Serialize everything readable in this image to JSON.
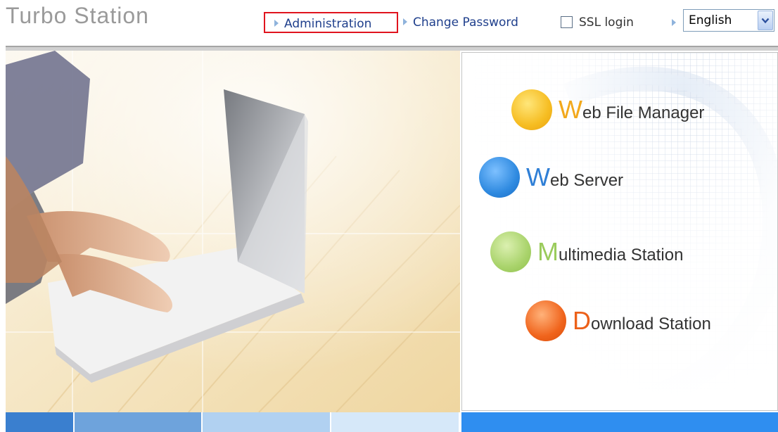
{
  "app": {
    "title": "Turbo Station"
  },
  "nav": {
    "administration": "Administration",
    "change_password": "Change Password",
    "ssl_login": "SSL login",
    "ssl_checked": false,
    "language_selected": "English"
  },
  "menu": {
    "items": [
      {
        "cap": "W",
        "rest": "eb File Manager",
        "color": "#f6bd22",
        "cap_color": "#f2a81b"
      },
      {
        "cap": "W",
        "rest": "eb Server",
        "color": "#2f8ae0",
        "cap_color": "#2f7fd6"
      },
      {
        "cap": "M",
        "rest": "ultimedia Station",
        "color": "#a9d36b",
        "cap_color": "#9acb5b"
      },
      {
        "cap": "D",
        "rest": "ownload Station",
        "color": "#f0641c",
        "cap_color": "#ec6019"
      }
    ]
  },
  "colors": {
    "accent": "#1f3f8c",
    "highlight_border": "#e0141e",
    "bar_segments": [
      "#3a7fcf",
      "#6ea3dc",
      "#b1d1f1",
      "#d6e8f9",
      "#ffffff",
      "#2f8ef0"
    ]
  }
}
